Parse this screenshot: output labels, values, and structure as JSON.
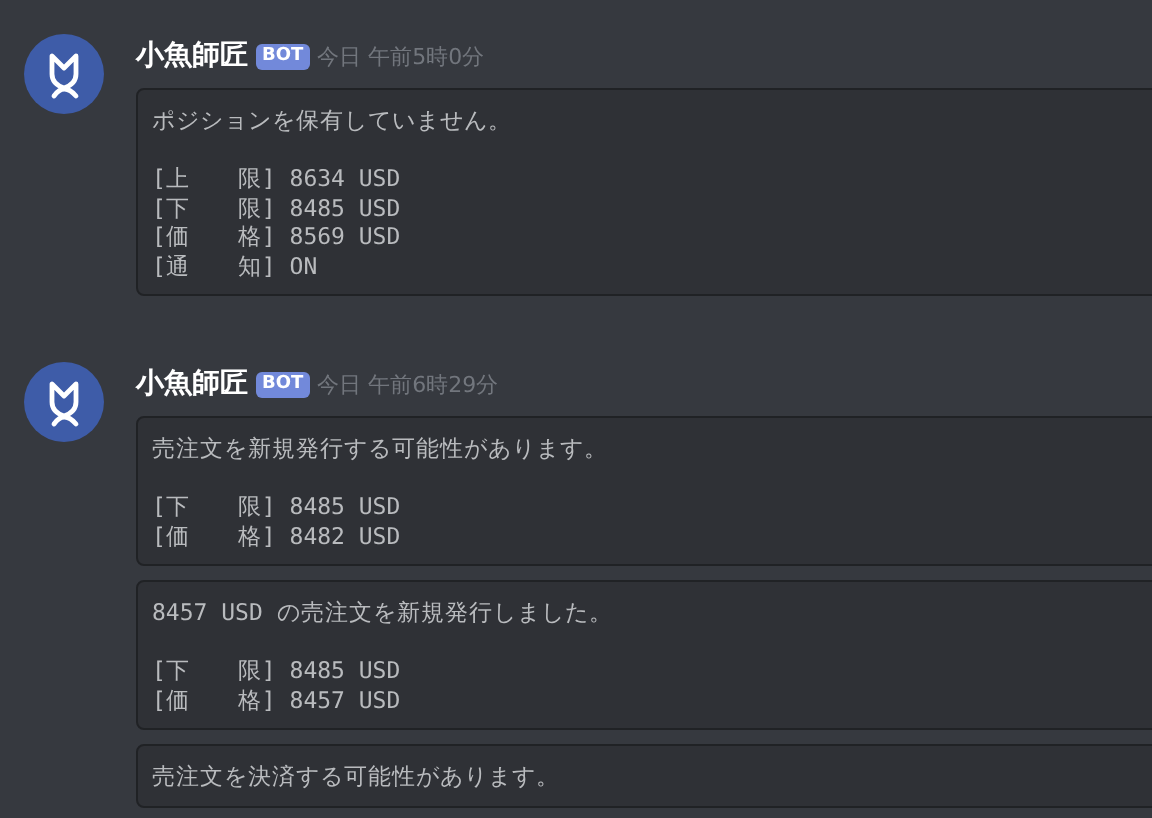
{
  "messages": [
    {
      "author": "小魚師匠",
      "badge": "BOT",
      "timestamp": "今日 午前5時0分",
      "blocks": [
        {
          "heading": "ポジションを保有していません。",
          "fields": [
            "[上　　限] 8634 USD",
            "[下　　限] 8485 USD",
            "[価　　格] 8569 USD",
            "[通　　知] ON"
          ]
        }
      ]
    },
    {
      "author": "小魚師匠",
      "badge": "BOT",
      "timestamp": "今日 午前6時29分",
      "blocks": [
        {
          "heading": "売注文を新規発行する可能性があります。",
          "fields": [
            "[下　　限] 8485 USD",
            "[価　　格] 8482 USD"
          ]
        },
        {
          "heading": "8457 USD の売注文を新規発行しました。",
          "fields": [
            "[下　　限] 8485 USD",
            "[価　　格] 8457 USD"
          ]
        },
        {
          "heading": "売注文を決済する可能性があります。"
        }
      ]
    }
  ]
}
